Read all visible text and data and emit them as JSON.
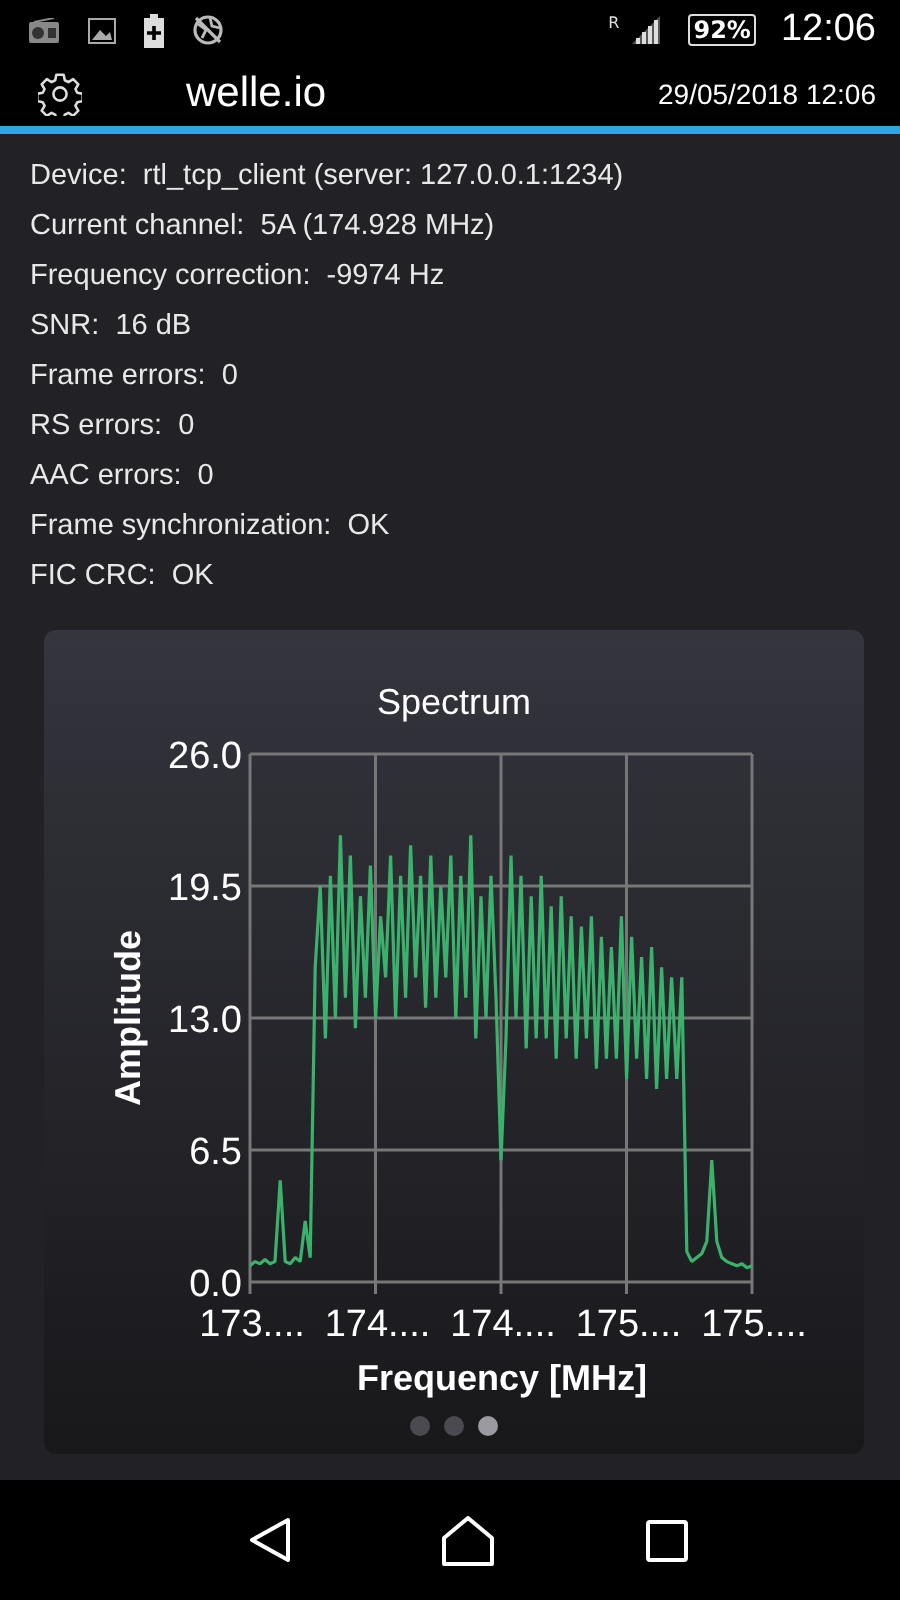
{
  "status_bar": {
    "roaming": "R",
    "battery": "92%",
    "time": "12:06"
  },
  "app_bar": {
    "title": "welle.io",
    "datetime": "29/05/2018 12:06"
  },
  "info": [
    {
      "label": "Device:",
      "value": "rtl_tcp_client (server: 127.0.0.1:1234)"
    },
    {
      "label": "Current channel:",
      "value": "5A (174.928 MHz)"
    },
    {
      "label": "Frequency correction:",
      "value": "-9974 Hz"
    },
    {
      "label": "SNR:",
      "value": "16 dB"
    },
    {
      "label": "Frame errors:",
      "value": "0"
    },
    {
      "label": "RS errors:",
      "value": "0"
    },
    {
      "label": "AAC errors:",
      "value": "0"
    },
    {
      "label": "Frame synchronization:",
      "value": "OK"
    },
    {
      "label": "FIC CRC:",
      "value": "OK"
    }
  ],
  "spectrum": {
    "chart_data": {
      "type": "line",
      "title": "Spectrum",
      "xlabel": "Frequency [MHz]",
      "ylabel": "Amplitude",
      "categories": [
        "173....",
        null,
        null,
        null,
        null,
        null,
        null,
        null,
        null,
        null,
        null,
        null,
        null,
        null,
        null,
        null,
        null,
        null,
        null,
        null,
        null,
        null,
        null,
        null,
        null,
        "174....",
        null,
        null,
        null,
        null,
        null,
        null,
        null,
        null,
        null,
        null,
        null,
        null,
        null,
        null,
        null,
        null,
        null,
        null,
        null,
        null,
        null,
        null,
        null,
        null,
        "174....",
        null,
        null,
        null,
        null,
        null,
        null,
        null,
        null,
        null,
        null,
        null,
        null,
        null,
        null,
        null,
        null,
        null,
        null,
        null,
        null,
        null,
        null,
        null,
        null,
        "175....",
        null,
        null,
        null,
        null,
        null,
        null,
        null,
        null,
        null,
        null,
        null,
        null,
        null,
        null,
        null,
        null,
        null,
        null,
        null,
        null,
        null,
        null,
        null,
        null,
        "175...."
      ],
      "series": [
        {
          "color": "#3bb26c",
          "values": [
            0.8,
            1.0,
            0.9,
            1.1,
            0.9,
            1.0,
            5.0,
            1.0,
            0.9,
            1.2,
            1.0,
            3.0,
            1.2,
            15.5,
            19.5,
            12,
            20,
            13,
            22,
            14,
            21,
            12.5,
            19,
            14,
            20.5,
            13,
            18,
            15,
            21,
            13,
            20,
            14,
            21.5,
            15,
            20,
            13.5,
            21,
            14,
            19.5,
            15,
            21,
            13,
            20,
            14,
            22,
            12,
            19,
            13,
            20,
            14,
            6,
            12,
            21,
            13,
            20,
            11.5,
            19,
            12,
            20,
            12,
            18.5,
            11,
            19,
            12,
            18,
            11,
            17.5,
            12,
            18,
            10.5,
            17,
            11,
            16.5,
            11,
            18,
            10,
            17,
            11,
            16,
            10,
            16.5,
            9.5,
            15.5,
            10,
            15,
            10,
            15,
            1.5,
            1.0,
            1.2,
            1.4,
            2.0,
            6.0,
            2.0,
            1.2,
            1.0,
            0.9,
            0.8,
            0.9,
            0.7,
            0.8
          ]
        }
      ],
      "ylim": [
        0,
        26
      ],
      "grid": true,
      "yticks": [
        {
          "value": 26,
          "label": "26.0"
        },
        {
          "value": 19.5,
          "label": "19.5"
        },
        {
          "value": 13,
          "label": "13.0"
        },
        {
          "value": 6.5,
          "label": "6.5"
        },
        {
          "value": 0,
          "label": "0.0"
        }
      ]
    }
  },
  "pages": [
    {
      "selected": false
    },
    {
      "selected": false
    },
    {
      "selected": true
    }
  ]
}
